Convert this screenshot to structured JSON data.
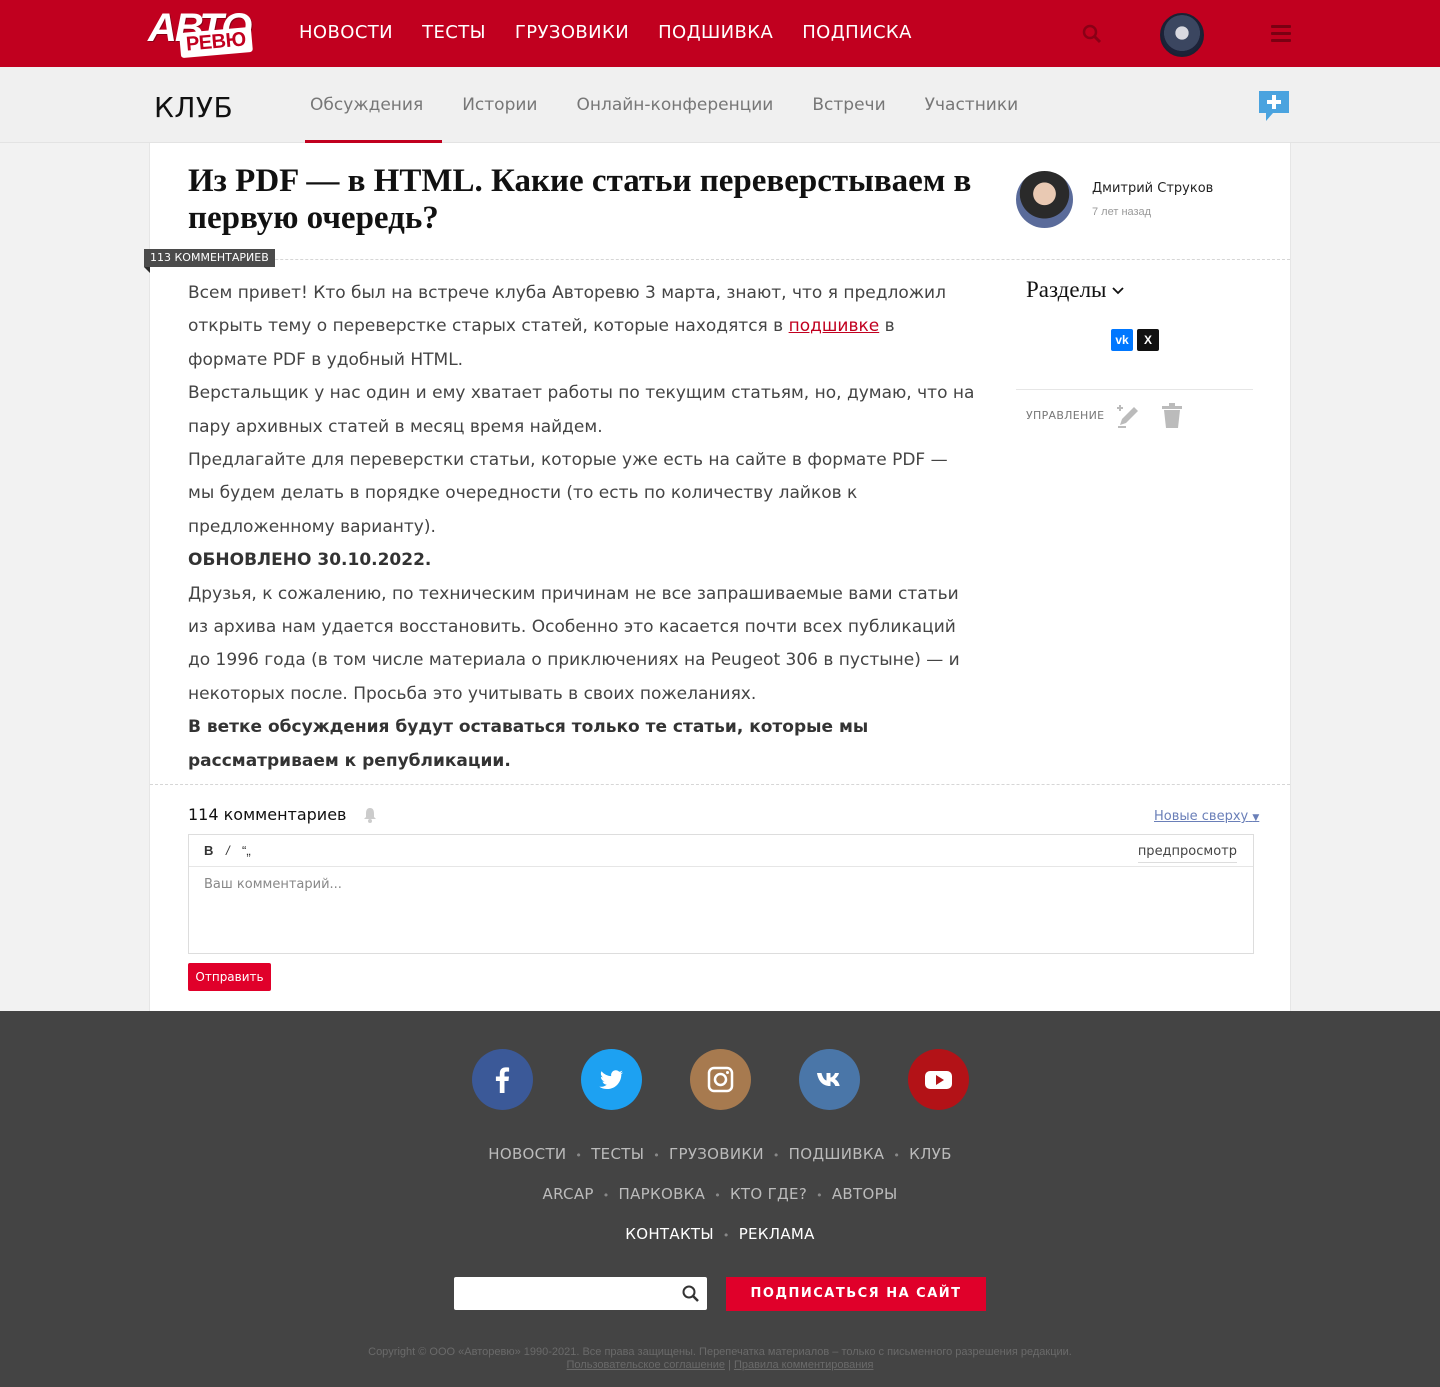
{
  "header": {
    "logo_top": "АВТО",
    "logo_bottom": "РЕВЮ",
    "nav": [
      "НОВОСТИ",
      "ТЕСТЫ",
      "ГРУЗОВИКИ",
      "ПОДШИВКА",
      "ПОДПИСКА"
    ],
    "icons": [
      "search-icon",
      "user-avatar",
      "menu-icon"
    ]
  },
  "club": {
    "title": "КЛУБ",
    "tabs": [
      "Обсуждения",
      "Истории",
      "Онлайн-конференции",
      "Встречи",
      "Участники"
    ],
    "active_tab": "Обсуждения"
  },
  "post": {
    "title": "Из PDF — в HTML. Какие статьи переверстываем в первую очередь?",
    "author": "Дмитрий Струков",
    "time": "7 лет назад",
    "comments_tag": "113 КОММЕНТАРИЕВ",
    "p1_before": "Всем привет! Кто был на встрече клуба Авторевю 3 марта, знают, что я предложил открыть тему о переверстке старых статей, которые находятся в ",
    "p1_link": "подшивке",
    "p1_after": " в формате PDF в удобный HTML.",
    "p2": "Верстальщик у нас один и ему хватает работы по текущим статьям, но, думаю, что на пару архивных статей в месяц время найдем.",
    "p3": "Предлагайте для переверстки статьи, которые уже есть на сайте в формате PDF — мы будем делать в порядке очередности (то есть по количеству лайков к предложенному варианту).",
    "p4": "ОБНОВЛЕНО 30.10.2022.",
    "p5": "Друзья, к сожалению, по техническим причинам не все запрашиваемые вами статьи из архива нам удается восстановить. Особенно это касается почти всех публикаций до 1996 года (в том числе материала о приключениях на Peugeot 306 в пустыне) — и некоторых после. Просьба это учитывать в своих пожеланиях.",
    "p6": "В ветке обсуждения будут оставаться только те статьи, которые мы рассматриваем к републикации."
  },
  "sidebar": {
    "sections_label": "Разделы",
    "share": [
      "vk",
      "x"
    ],
    "manage_label": "УПРАВЛЕНИЕ"
  },
  "comments": {
    "count_label": "114 комментариев",
    "sort_label": "Новые сверху",
    "tools": [
      "B",
      "/",
      "“„"
    ],
    "preview_label": "предпросмотр",
    "placeholder": "Ваш комментарий...",
    "send_label": "Отправить"
  },
  "footer": {
    "socials": [
      {
        "name": "facebook",
        "color": "#3b5998"
      },
      {
        "name": "twitter",
        "color": "#1da1f2"
      },
      {
        "name": "instagram",
        "color": "#a77a4f"
      },
      {
        "name": "vk",
        "color": "#4a76a8"
      },
      {
        "name": "youtube",
        "color": "#b31217"
      }
    ],
    "nav1": [
      "НОВОСТИ",
      "ТЕСТЫ",
      "ГРУЗОВИКИ",
      "ПОДШИВКА",
      "КЛУБ"
    ],
    "nav2": [
      "ARCAP",
      "ПАРКОВКА",
      "КТО ГДЕ?",
      "АВТОРЫ"
    ],
    "nav3": [
      "КОНТАКТЫ",
      "РЕКЛАМА"
    ],
    "subscribe_label": "ПОДПИСАТЬСЯ НА САЙТ",
    "copyright": "Copyright © ООО «Авторевю» 1990-2021. Все права защищены. Перепечатка материалов – только с письменного разрешения редакции.",
    "link1": "Пользовательское соглашение",
    "divider": "|",
    "link2": "Правила комментирования"
  },
  "colors": {
    "brand": "#c1001f",
    "accent_button": "#e0002a",
    "footer_bg": "#444444"
  }
}
